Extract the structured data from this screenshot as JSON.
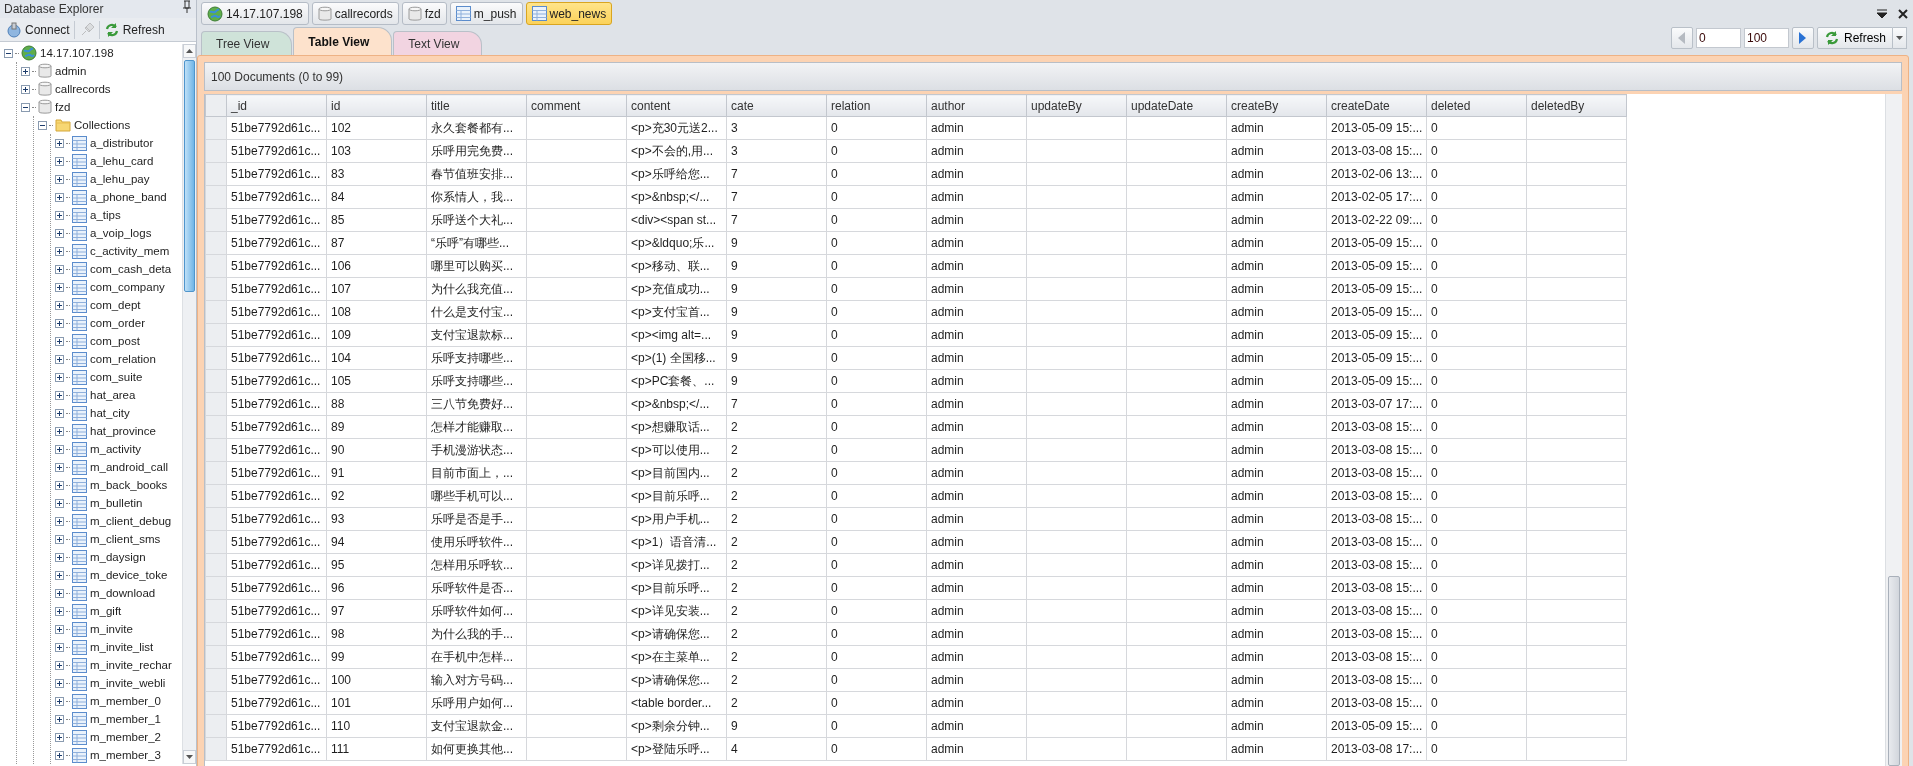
{
  "sidebar": {
    "title": "Database Explorer",
    "toolbar": [
      {
        "kind": "connect",
        "label": "Connect",
        "disabled": false
      },
      {
        "kind": "disconnect",
        "disabled": true
      },
      {
        "kind": "refresh",
        "label": "Refresh",
        "disabled": false
      }
    ],
    "tree": [
      {
        "kind": "server",
        "label": "14.17.107.198",
        "expanded": true,
        "children": [
          {
            "kind": "database",
            "label": "admin",
            "expanded": false
          },
          {
            "kind": "database",
            "label": "callrecords",
            "expanded": false
          },
          {
            "kind": "database",
            "label": "fzd",
            "expanded": true,
            "children": [
              {
                "kind": "folder",
                "label": "Collections",
                "expanded": true,
                "children": [
                  {
                    "kind": "collection",
                    "label": "a_distributor",
                    "expanded": false
                  },
                  {
                    "kind": "collection",
                    "label": "a_lehu_card",
                    "expanded": false
                  },
                  {
                    "kind": "collection",
                    "label": "a_lehu_pay",
                    "expanded": false
                  },
                  {
                    "kind": "collection",
                    "label": "a_phone_band",
                    "expanded": false
                  },
                  {
                    "kind": "collection",
                    "label": "a_tips",
                    "expanded": false
                  },
                  {
                    "kind": "collection",
                    "label": "a_voip_logs",
                    "expanded": false
                  },
                  {
                    "kind": "collection",
                    "label": "c_activity_mem",
                    "expanded": false
                  },
                  {
                    "kind": "collection",
                    "label": "com_cash_deta",
                    "expanded": false
                  },
                  {
                    "kind": "collection",
                    "label": "com_company",
                    "expanded": false
                  },
                  {
                    "kind": "collection",
                    "label": "com_dept",
                    "expanded": false
                  },
                  {
                    "kind": "collection",
                    "label": "com_order",
                    "expanded": false
                  },
                  {
                    "kind": "collection",
                    "label": "com_post",
                    "expanded": false
                  },
                  {
                    "kind": "collection",
                    "label": "com_relation",
                    "expanded": false
                  },
                  {
                    "kind": "collection",
                    "label": "com_suite",
                    "expanded": false
                  },
                  {
                    "kind": "collection",
                    "label": "hat_area",
                    "expanded": false
                  },
                  {
                    "kind": "collection",
                    "label": "hat_city",
                    "expanded": false
                  },
                  {
                    "kind": "collection",
                    "label": "hat_province",
                    "expanded": false
                  },
                  {
                    "kind": "collection",
                    "label": "m_activity",
                    "expanded": false
                  },
                  {
                    "kind": "collection",
                    "label": "m_android_call",
                    "expanded": false
                  },
                  {
                    "kind": "collection",
                    "label": "m_back_books",
                    "expanded": false
                  },
                  {
                    "kind": "collection",
                    "label": "m_bulletin",
                    "expanded": false
                  },
                  {
                    "kind": "collection",
                    "label": "m_client_debug",
                    "expanded": false
                  },
                  {
                    "kind": "collection",
                    "label": "m_client_sms",
                    "expanded": false
                  },
                  {
                    "kind": "collection",
                    "label": "m_daysign",
                    "expanded": false
                  },
                  {
                    "kind": "collection",
                    "label": "m_device_toke",
                    "expanded": false
                  },
                  {
                    "kind": "collection",
                    "label": "m_download",
                    "expanded": false
                  },
                  {
                    "kind": "collection",
                    "label": "m_gift",
                    "expanded": false
                  },
                  {
                    "kind": "collection",
                    "label": "m_invite",
                    "expanded": false
                  },
                  {
                    "kind": "collection",
                    "label": "m_invite_list",
                    "expanded": false
                  },
                  {
                    "kind": "collection",
                    "label": "m_invite_rechar",
                    "expanded": false
                  },
                  {
                    "kind": "collection",
                    "label": "m_invite_webli",
                    "expanded": false
                  },
                  {
                    "kind": "collection",
                    "label": "m_member_0",
                    "expanded": false
                  },
                  {
                    "kind": "collection",
                    "label": "m_member_1",
                    "expanded": false
                  },
                  {
                    "kind": "collection",
                    "label": "m_member_2",
                    "expanded": false
                  },
                  {
                    "kind": "collection",
                    "label": "m_member_3",
                    "expanded": false
                  }
                ]
              }
            ]
          }
        ]
      }
    ]
  },
  "doc_tabs": [
    {
      "kind": "server",
      "label": "14.17.107.198",
      "selected": false
    },
    {
      "kind": "database",
      "label": "callrecords",
      "selected": false
    },
    {
      "kind": "database",
      "label": "fzd",
      "selected": false
    },
    {
      "kind": "collection",
      "label": "m_push",
      "selected": false
    },
    {
      "kind": "collection",
      "label": "web_news",
      "selected": true
    }
  ],
  "view_tabs": [
    {
      "label": "Tree View",
      "selected": false,
      "color": "#cfe3d9"
    },
    {
      "label": "Table View",
      "selected": true,
      "color": "#fde2cc"
    },
    {
      "label": "Text View",
      "selected": false,
      "color": "#f2d4e1"
    }
  ],
  "pager": {
    "prev_disabled": true,
    "skip": "0",
    "limit": "100",
    "next_disabled": false,
    "refresh": "Refresh"
  },
  "result": {
    "summary": "100 Documents (0 to 99)",
    "columns": [
      "_id",
      "id",
      "title",
      "comment",
      "content",
      "cate",
      "relation",
      "author",
      "updateBy",
      "updateDate",
      "createBy",
      "createDate",
      "deleted",
      "deletedBy"
    ],
    "rows": [
      [
        "51be7792d61c...",
        "102",
        "永久套餐都有...",
        null,
        "<p>充30元送2...",
        "3",
        "0",
        "admin",
        null,
        null,
        "admin",
        "2013-05-09 15:...",
        "0",
        null
      ],
      [
        "51be7792d61c...",
        "103",
        "乐呼用完免费...",
        null,
        "<p>不会的,用...",
        "3",
        "0",
        "admin",
        null,
        null,
        "admin",
        "2013-03-08 15:...",
        "0",
        null
      ],
      [
        "51be7792d61c...",
        "83",
        "春节值班安排...",
        null,
        "<p>乐呼给您...",
        "7",
        "0",
        "admin",
        null,
        null,
        "admin",
        "2013-02-06 13:...",
        "0",
        null
      ],
      [
        "51be7792d61c...",
        "84",
        "你系情人，我...",
        null,
        "<p>&nbsp;</...",
        "7",
        "0",
        "admin",
        null,
        null,
        "admin",
        "2013-02-05 17:...",
        "0",
        null
      ],
      [
        "51be7792d61c...",
        "85",
        "乐呼送个大礼...",
        null,
        "<div><span st...",
        "7",
        "0",
        "admin",
        null,
        null,
        "admin",
        "2013-02-22 09:...",
        "0",
        null
      ],
      [
        "51be7792d61c...",
        "87",
        "“乐呼”有哪些...",
        null,
        "<p>&ldquo;乐...",
        "9",
        "0",
        "admin",
        null,
        null,
        "admin",
        "2013-05-09 15:...",
        "0",
        null
      ],
      [
        "51be7792d61c...",
        "106",
        "哪里可以购买...",
        null,
        "<p>移动、联...",
        "9",
        "0",
        "admin",
        null,
        null,
        "admin",
        "2013-05-09 15:...",
        "0",
        null
      ],
      [
        "51be7792d61c...",
        "107",
        "为什么我充值...",
        null,
        "<p>充值成功...",
        "9",
        "0",
        "admin",
        null,
        null,
        "admin",
        "2013-05-09 15:...",
        "0",
        null
      ],
      [
        "51be7792d61c...",
        "108",
        "什么是支付宝...",
        null,
        "<p>支付宝首...",
        "9",
        "0",
        "admin",
        null,
        null,
        "admin",
        "2013-05-09 15:...",
        "0",
        null
      ],
      [
        "51be7792d61c...",
        "109",
        "支付宝退款标...",
        null,
        "<p><img alt=...",
        "9",
        "0",
        "admin",
        null,
        null,
        "admin",
        "2013-05-09 15:...",
        "0",
        null
      ],
      [
        "51be7792d61c...",
        "104",
        "乐呼支持哪些...",
        null,
        "<p>(1) 全国移...",
        "9",
        "0",
        "admin",
        null,
        null,
        "admin",
        "2013-05-09 15:...",
        "0",
        null
      ],
      [
        "51be7792d61c...",
        "105",
        "乐呼支持哪些...",
        null,
        "<p>PC套餐、...",
        "9",
        "0",
        "admin",
        null,
        null,
        "admin",
        "2013-05-09 15:...",
        "0",
        null
      ],
      [
        "51be7792d61c...",
        "88",
        "三八节免费好...",
        null,
        "<p>&nbsp;</...",
        "7",
        "0",
        "admin",
        null,
        null,
        "admin",
        "2013-03-07 17:...",
        "0",
        null
      ],
      [
        "51be7792d61c...",
        "89",
        "怎样才能赚取...",
        null,
        "<p>想赚取话...",
        "2",
        "0",
        "admin",
        null,
        null,
        "admin",
        "2013-03-08 15:...",
        "0",
        null
      ],
      [
        "51be7792d61c...",
        "90",
        "手机漫游状态...",
        null,
        "<p>可以使用...",
        "2",
        "0",
        "admin",
        null,
        null,
        "admin",
        "2013-03-08 15:...",
        "0",
        null
      ],
      [
        "51be7792d61c...",
        "91",
        "目前市面上，...",
        null,
        "<p>目前国内...",
        "2",
        "0",
        "admin",
        null,
        null,
        "admin",
        "2013-03-08 15:...",
        "0",
        null
      ],
      [
        "51be7792d61c...",
        "92",
        "哪些手机可以...",
        null,
        "<p>目前乐呼...",
        "2",
        "0",
        "admin",
        null,
        null,
        "admin",
        "2013-03-08 15:...",
        "0",
        null
      ],
      [
        "51be7792d61c...",
        "93",
        "乐呼是否是手...",
        null,
        "<p>用户手机...",
        "2",
        "0",
        "admin",
        null,
        null,
        "admin",
        "2013-03-08 15:...",
        "0",
        null
      ],
      [
        "51be7792d61c...",
        "94",
        "使用乐呼软件...",
        null,
        "<p>1）语音清...",
        "2",
        "0",
        "admin",
        null,
        null,
        "admin",
        "2013-03-08 15:...",
        "0",
        null
      ],
      [
        "51be7792d61c...",
        "95",
        "怎样用乐呼软...",
        null,
        "<p>详见拨打...",
        "2",
        "0",
        "admin",
        null,
        null,
        "admin",
        "2013-03-08 15:...",
        "0",
        null
      ],
      [
        "51be7792d61c...",
        "96",
        "乐呼软件是否...",
        null,
        "<p>目前乐呼...",
        "2",
        "0",
        "admin",
        null,
        null,
        "admin",
        "2013-03-08 15:...",
        "0",
        null
      ],
      [
        "51be7792d61c...",
        "97",
        "乐呼软件如何...",
        null,
        "<p>详见安装...",
        "2",
        "0",
        "admin",
        null,
        null,
        "admin",
        "2013-03-08 15:...",
        "0",
        null
      ],
      [
        "51be7792d61c...",
        "98",
        "为什么我的手...",
        null,
        "<p>请确保您...",
        "2",
        "0",
        "admin",
        null,
        null,
        "admin",
        "2013-03-08 15:...",
        "0",
        null
      ],
      [
        "51be7792d61c...",
        "99",
        "在手机中怎样...",
        null,
        "<p>在主菜单...",
        "2",
        "0",
        "admin",
        null,
        null,
        "admin",
        "2013-03-08 15:...",
        "0",
        null
      ],
      [
        "51be7792d61c...",
        "100",
        "输入对方号码...",
        null,
        "<p>请确保您...",
        "2",
        "0",
        "admin",
        null,
        null,
        "admin",
        "2013-03-08 15:...",
        "0",
        null
      ],
      [
        "51be7792d61c...",
        "101",
        "乐呼用户如何...",
        null,
        "<table border...",
        "2",
        "0",
        "admin",
        null,
        null,
        "admin",
        "2013-03-08 15:...",
        "0",
        null
      ],
      [
        "51be7792d61c...",
        "110",
        "支付宝退款金...",
        null,
        "<p>剩余分钟...",
        "9",
        "0",
        "admin",
        null,
        null,
        "admin",
        "2013-05-09 15:...",
        "0",
        null
      ],
      [
        "51be7792d61c...",
        "111",
        "如何更换其他...",
        null,
        "<p>登陆乐呼...",
        "4",
        "0",
        "admin",
        null,
        null,
        "admin",
        "2013-03-08 17:...",
        "0",
        null
      ]
    ]
  }
}
